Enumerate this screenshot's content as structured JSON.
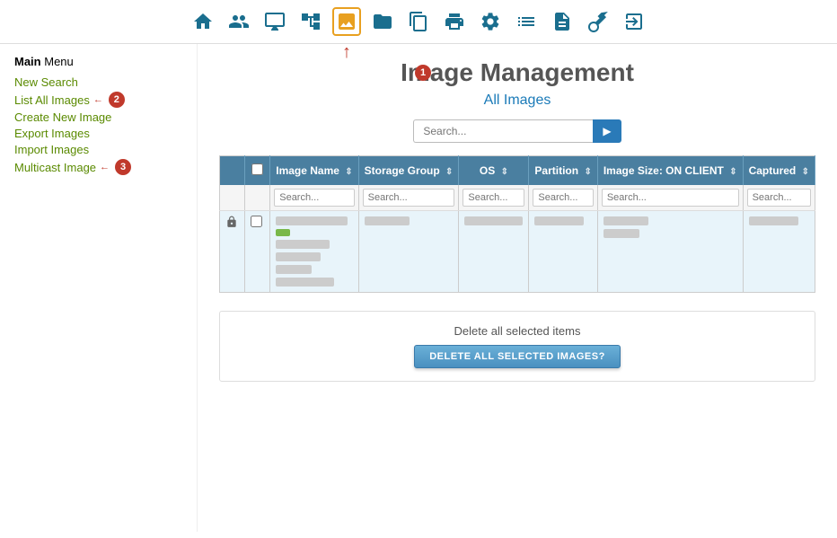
{
  "nav": {
    "icons": [
      {
        "name": "home-icon",
        "symbol": "🏠"
      },
      {
        "name": "users-icon",
        "symbol": "👥"
      },
      {
        "name": "monitor-icon",
        "symbol": "🖥"
      },
      {
        "name": "network-icon",
        "symbol": "🌐"
      },
      {
        "name": "image-icon",
        "symbol": "🖼",
        "active": true
      },
      {
        "name": "folder-icon",
        "symbol": "📁"
      },
      {
        "name": "copy-icon",
        "symbol": "📋"
      },
      {
        "name": "print-icon",
        "symbol": "🖨"
      },
      {
        "name": "settings-icon",
        "symbol": "⚙"
      },
      {
        "name": "list-icon",
        "symbol": "☰"
      },
      {
        "name": "doc-icon",
        "symbol": "📄"
      },
      {
        "name": "wrench-icon",
        "symbol": "🔧"
      },
      {
        "name": "logout-icon",
        "symbol": "↪"
      }
    ]
  },
  "sidebar": {
    "title": "Main",
    "title_suffix": " Menu",
    "links": [
      {
        "label": "New Search",
        "badge": null
      },
      {
        "label": "List All Images",
        "badge": "2"
      },
      {
        "label": "Create New Image",
        "badge": null
      },
      {
        "label": "Export Images",
        "badge": null
      },
      {
        "label": "Import Images",
        "badge": null
      },
      {
        "label": "Multicast Image",
        "badge": "3"
      }
    ]
  },
  "main": {
    "title": "Image Management",
    "subtitle": "All Images",
    "badge1": "1",
    "search_placeholder": "Search...",
    "search_btn": "▶",
    "table": {
      "columns": [
        {
          "label": ""
        },
        {
          "label": ""
        },
        {
          "label": "Image Name"
        },
        {
          "label": "Storage Group"
        },
        {
          "label": "OS"
        },
        {
          "label": "Partition"
        },
        {
          "label": "Image Size: ON CLIENT"
        },
        {
          "label": "Captured"
        }
      ],
      "filter_placeholders": [
        "Search...",
        "Search...",
        "Search...",
        "Search...",
        "Search...",
        "Search..."
      ]
    },
    "footer": {
      "label": "Delete all selected items",
      "button": "Delete all selected images?"
    }
  }
}
